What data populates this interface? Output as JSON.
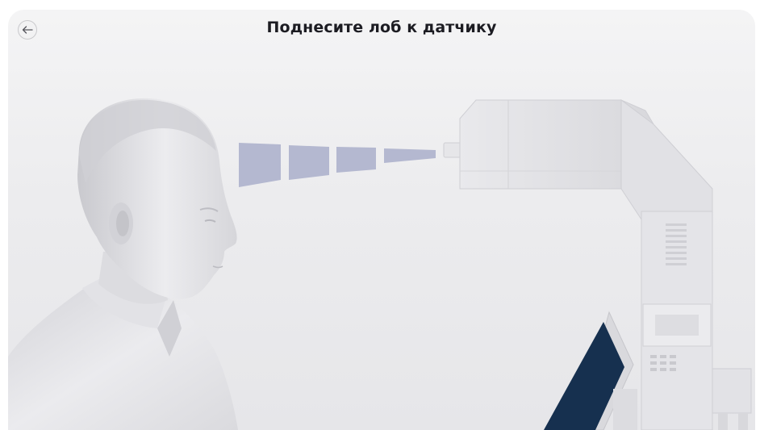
{
  "header": {
    "title": "Поднесите лоб к датчику",
    "back_icon": "arrow-left-icon"
  },
  "colors": {
    "background": "#ececee",
    "title_text": "#1c1c22",
    "beam": "#b4b8d0",
    "monitor_screen": "#16304f",
    "device_body": "#e4e4e7",
    "figure": "#dcdce0"
  }
}
